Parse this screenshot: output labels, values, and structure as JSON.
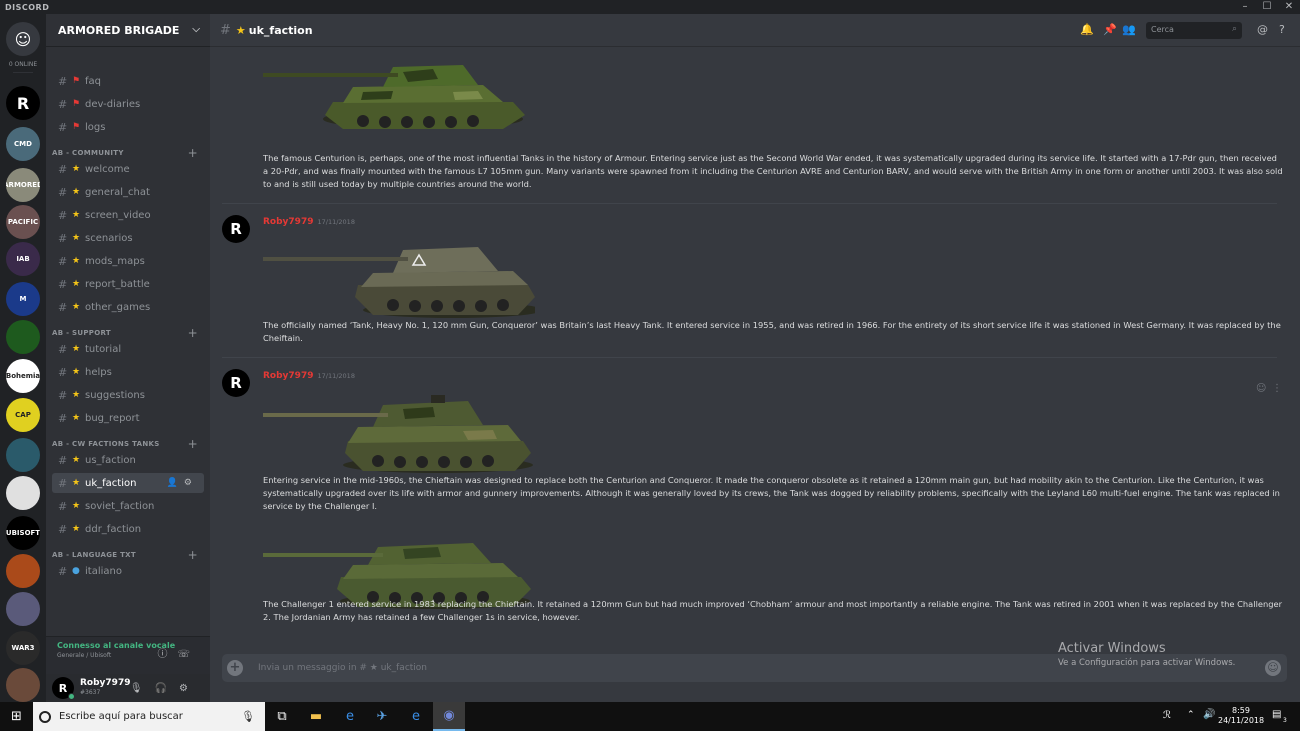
{
  "titlebar": {
    "brand": "DISCORD",
    "min": "–",
    "max": "☐",
    "close": "✕"
  },
  "guilds": {
    "online_text": "0 ONLINE",
    "items": [
      {
        "name": "discord-home",
        "label": "",
        "color": "#36393f"
      },
      {
        "name": "R",
        "label": "R",
        "color": "#000000"
      },
      {
        "name": "guild-2",
        "label": "CMD",
        "color": "#4a6a7a"
      },
      {
        "name": "armored-brigade",
        "label": "ARMORED",
        "color": "#8a8a7a"
      },
      {
        "name": "pacific",
        "label": "PACIFIC",
        "color": "#6a5050"
      },
      {
        "name": "iab",
        "label": "IAB",
        "color": "#3a2a4a"
      },
      {
        "name": "guild-m",
        "label": "M",
        "color": "#1b3a8a"
      },
      {
        "name": "guild-green",
        "label": "",
        "color": "#1e5a1e"
      },
      {
        "name": "bohemia",
        "label": "Bohemia",
        "color": "#ffffff"
      },
      {
        "name": "guild-yellow",
        "label": "CAP",
        "color": "#e0d020"
      },
      {
        "name": "guild-dragon",
        "label": "",
        "color": "#2a5a6a"
      },
      {
        "name": "guild-tank",
        "label": "",
        "color": "#e0e0e0"
      },
      {
        "name": "ubisoft",
        "label": "UBISOFT",
        "color": "#000000"
      },
      {
        "name": "guild-fire",
        "label": "",
        "color": "#aa4a1a"
      },
      {
        "name": "guild-soldier",
        "label": "",
        "color": "#5a5a7a"
      },
      {
        "name": "war3",
        "label": "WAR3",
        "color": "#2a2a2a"
      },
      {
        "name": "guild-last",
        "label": "",
        "color": "#6a4a3a"
      }
    ]
  },
  "server": {
    "name": "ARMORED BRIGADE"
  },
  "channels": [
    {
      "type": "chan",
      "icon": "🚩",
      "label": "faq",
      "active": false
    },
    {
      "type": "chan",
      "icon": "🚩",
      "label": "dev-diaries",
      "active": false
    },
    {
      "type": "chan",
      "icon": "🚩",
      "label": "logs",
      "active": false
    },
    {
      "type": "cat",
      "label": "AB - COMMUNITY"
    },
    {
      "type": "chan",
      "icon": "★",
      "label": "welcome",
      "active": false
    },
    {
      "type": "chan",
      "icon": "★",
      "label": "general_chat",
      "active": false
    },
    {
      "type": "chan",
      "icon": "★",
      "label": "screen_video",
      "active": false
    },
    {
      "type": "chan",
      "icon": "★",
      "label": "scenarios",
      "active": false
    },
    {
      "type": "chan",
      "icon": "★",
      "label": "mods_maps",
      "active": false
    },
    {
      "type": "chan",
      "icon": "★",
      "label": "report_battle",
      "active": false
    },
    {
      "type": "chan",
      "icon": "★",
      "label": "other_games",
      "active": false
    },
    {
      "type": "cat",
      "label": "AB - SUPPORT"
    },
    {
      "type": "chan",
      "icon": "★",
      "label": "tutorial",
      "active": false
    },
    {
      "type": "chan",
      "icon": "★",
      "label": "helps",
      "active": false
    },
    {
      "type": "chan",
      "icon": "★",
      "label": "suggestions",
      "active": false
    },
    {
      "type": "chan",
      "icon": "★",
      "label": "bug_report",
      "active": false
    },
    {
      "type": "cat",
      "label": "AB - CW FACTIONS TANKS"
    },
    {
      "type": "chan",
      "icon": "★",
      "label": "us_faction",
      "active": false
    },
    {
      "type": "chan",
      "icon": "★",
      "label": "uk_faction",
      "active": true
    },
    {
      "type": "chan",
      "icon": "★",
      "label": "soviet_faction",
      "active": false
    },
    {
      "type": "chan",
      "icon": "★",
      "label": "ddr_faction",
      "active": false
    },
    {
      "type": "cat",
      "label": "AB - LANGUAGE TXT"
    },
    {
      "type": "chan",
      "icon": "🌐",
      "label": "italiano",
      "active": false
    }
  ],
  "voice": {
    "status": "Connesso al canale vocale",
    "detail": "Generale / Ubisoft"
  },
  "user": {
    "name": "Roby7979",
    "discriminator": "#3637"
  },
  "channel": {
    "name": "uk_faction"
  },
  "header": {
    "search_placeholder": "Cerca"
  },
  "messages": [
    {
      "author": "",
      "time": "",
      "text": "The famous Centurion is, perhaps, one of the most influential Tanks in the history of Armour. Entering service just as the Second World War ended, it was systematically upgraded during its service life. It started with a 17-Pdr gun, then received a 20-Pdr, and was finally mounted with the famous L7 105mm gun. Many variants were spawned from it including the Centurion AVRE and Centurion BARV, and would serve with the British Army in one form or another until 2003. It was also sold to and is still used today by multiple countries around the world."
    },
    {
      "author": "Roby7979",
      "time": "17/11/2018",
      "text": "The officially named ‘Tank, Heavy No. 1, 120 mm Gun, Conqueror’ was Britain’s last Heavy Tank. It entered service in 1955, and was retired in 1966. For the entirety of its short service life it was stationed in West Germany. It was replaced by the Cheiftain."
    },
    {
      "author": "Roby7979",
      "time": "17/11/2018",
      "text": "Entering service in the mid-1960s, the Chieftain was designed to replace both the Centurion and Conqueror. It made the conqueror obsolete as it retained a 120mm main gun, but had mobility akin to the Centurion. Like the Centurion, it was systematically upgraded over its life with armor and gunnery improvements. Although it was generally loved by its crews, the Tank was dogged by reliability problems, specifically with the Leyland L60 multi-fuel engine. The tank was replaced in service by the Challenger I."
    },
    {
      "author": "",
      "time": "",
      "text": "The Challenger 1 entered service in 1983 replacing the Chieftain. It retained a 120mm Gun but had much improved ‘Chobham’ armour and most importantly a reliable engine. The Tank was retired in 2001 when it was replaced by the Challenger 2. The Jordanian Army has retained a few Challenger 1s in service, however."
    }
  ],
  "composer": {
    "placeholder": "Invia un messaggio in # ★ uk_faction"
  },
  "watermark": {
    "line1": "Activar Windows",
    "line2": "Ve a Configuración para activar Windows."
  },
  "taskbar": {
    "search_placeholder": "Escribe aquí para buscar",
    "time": "8:59",
    "date": "24/11/2018",
    "notif_count": "3"
  },
  "colors": {
    "author": "#e53935",
    "online": "#43b581",
    "star": "#f5c518",
    "flag": "#e53935"
  }
}
